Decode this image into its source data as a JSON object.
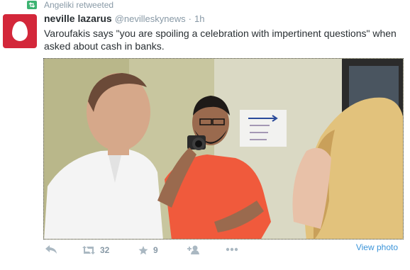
{
  "retweet": {
    "text": "Angeliki retweeted",
    "icon": "retweet-icon"
  },
  "tweet": {
    "author_name": "neville lazarus",
    "author_handle": "@nevilleskynews",
    "separator": "·",
    "time": "1h",
    "text": "Varoufakis says \"you are spoiling a celebration with impertinent questions\" when asked about cash in banks.",
    "avatar_color": "#d3273a"
  },
  "actions": {
    "retweet_count": "32",
    "favorite_count": "9",
    "view_photo": "View photo"
  },
  "colors": {
    "link": "#3b94d9",
    "muted": "#8899a6",
    "icon": "#aab8c2"
  }
}
